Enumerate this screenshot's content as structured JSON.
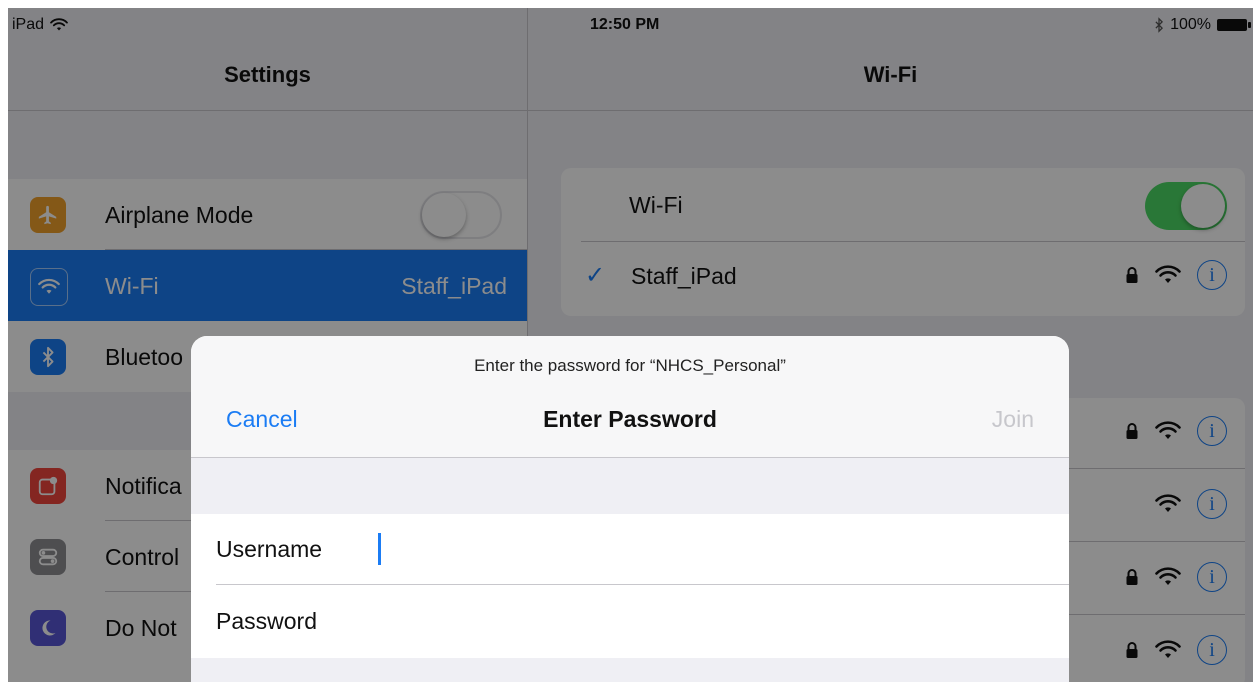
{
  "status": {
    "device": "iPad",
    "time": "12:50 PM",
    "battery": "100%"
  },
  "settings": {
    "title": "Settings",
    "items": [
      {
        "label": "Airplane Mode",
        "detail": "",
        "color": "#f0a12b"
      },
      {
        "label": "Wi-Fi",
        "detail": "Staff_iPad",
        "color": "#1b7cf4"
      },
      {
        "label": "Bluetoo",
        "detail": "",
        "color": "#1b7cf4"
      },
      {
        "label": "Notifica",
        "detail": "",
        "color": "#f0463c"
      },
      {
        "label": "Control",
        "detail": "",
        "color": "#8e8e93"
      },
      {
        "label": "Do Not",
        "detail": "",
        "color": "#5856d6"
      }
    ]
  },
  "wifi": {
    "title": "Wi-Fi",
    "toggle_label": "Wi-Fi",
    "connected": "Staff_iPad"
  },
  "dialog": {
    "prompt": "Enter the password for “NHCS_Personal”",
    "title": "Enter Password",
    "cancel": "Cancel",
    "join": "Join",
    "username_label": "Username",
    "password_label": "Password"
  },
  "colors": {
    "accent": "#1b7cf4",
    "toggle_on": "#4cd964"
  }
}
